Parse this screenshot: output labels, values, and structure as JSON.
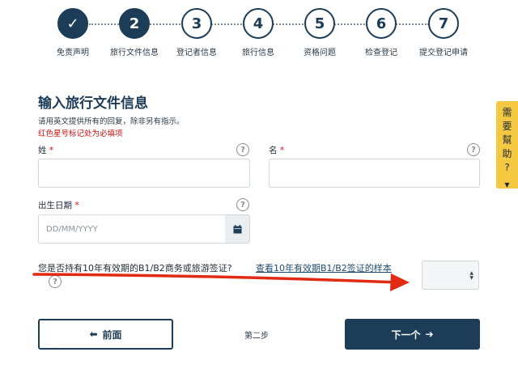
{
  "steps": [
    {
      "number": "✓",
      "label": "免责声明",
      "state": "done"
    },
    {
      "number": "2",
      "label": "旅行文件信息",
      "state": "active"
    },
    {
      "number": "3",
      "label": "登记者信息",
      "state": "pending"
    },
    {
      "number": "4",
      "label": "旅行信息",
      "state": "pending"
    },
    {
      "number": "5",
      "label": "资格问题",
      "state": "pending"
    },
    {
      "number": "6",
      "label": "检查登记",
      "state": "pending"
    },
    {
      "number": "7",
      "label": "提交登记申请",
      "state": "pending"
    }
  ],
  "form": {
    "title": "输入旅行文件信息",
    "instruction": "请用英文提供所有的回复，除非另有指示。",
    "required_note": "红色星号标记处为必填项",
    "surname_label": "姓",
    "given_name_label": "名",
    "dob_label": "出生日期",
    "dob_placeholder": "DD/MM/YYYY",
    "required_mark": "*",
    "help_mark": "?",
    "visa_question": "您是否持有10年有效期的B1/B2商务或旅游签证?",
    "visa_sample_link": "查看10年有效期B1/B2签证的样本"
  },
  "nav": {
    "prev_label": "前面",
    "step_indicator": "第二步",
    "next_label": "下一个"
  },
  "help_tab": {
    "chars": [
      "需",
      "要",
      "幫",
      "助",
      "?"
    ]
  },
  "colors": {
    "primary": "#1c3c57",
    "required_red": "#cc1111",
    "annotation_arrow": "#e02a12",
    "help_tab_bg": "#f5c842"
  }
}
